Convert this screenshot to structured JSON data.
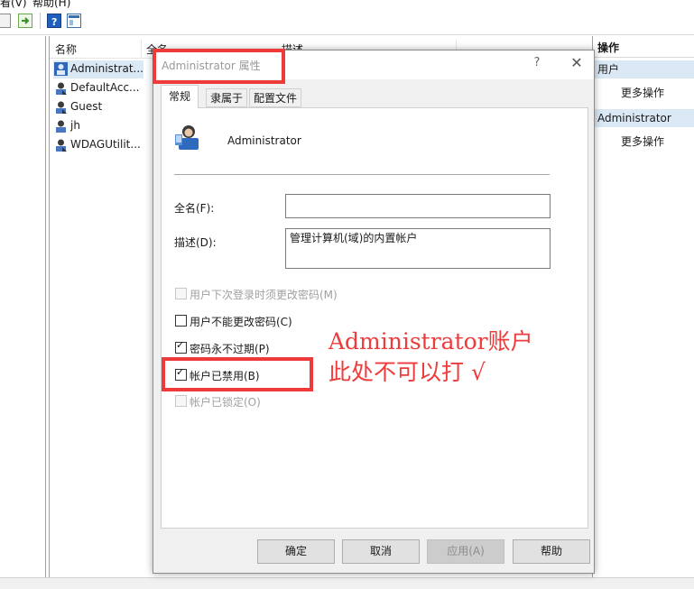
{
  "menubar": {
    "view_label": "看(V)",
    "help_label": "帮助(H)"
  },
  "list": {
    "columns": [
      "名称",
      "全名",
      "描述"
    ],
    "rows": [
      "Administrat...",
      "DefaultAcc...",
      "Guest",
      "jh",
      "WDAGUtilit..."
    ]
  },
  "actions": {
    "header": "操作",
    "sections": [
      {
        "title": "用户",
        "item": "更多操作"
      },
      {
        "title": "Administrator",
        "item": "更多操作"
      }
    ]
  },
  "dialog": {
    "title": "Administrator 属性",
    "help_glyph": "?",
    "close_glyph": "✕",
    "tabs": [
      "常规",
      "隶属于",
      "配置文件"
    ],
    "user_name": "Administrator",
    "fullname_label": "全名(F):",
    "fullname_value": "",
    "desc_label": "描述(D):",
    "desc_value": "管理计算机(域)的内置帐户",
    "checkboxes": [
      {
        "label": "用户下次登录时须更改密码(M)",
        "checked": false,
        "enabled": false
      },
      {
        "label": "用户不能更改密码(C)",
        "checked": false,
        "enabled": true
      },
      {
        "label": "密码永不过期(P)",
        "checked": true,
        "enabled": true
      },
      {
        "label": "帐户已禁用(B)",
        "checked": true,
        "enabled": true
      },
      {
        "label": "帐户已锁定(O)",
        "checked": false,
        "enabled": false
      }
    ],
    "buttons": {
      "ok": "确定",
      "cancel": "取消",
      "apply": "应用(A)",
      "help": "帮助"
    }
  },
  "annotation": {
    "line1": "Administrator账户",
    "line2": "此处不可以打 √",
    "color": "#ee3b3b"
  },
  "colors": {
    "selection": "#dbe8f5",
    "dialog_bg": "#f0f0f0",
    "annotation_red": "#ef3a3a"
  }
}
